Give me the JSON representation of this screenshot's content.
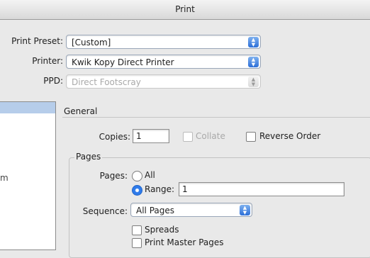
{
  "window": {
    "title": "Print"
  },
  "top": {
    "preset_label": "Print Preset:",
    "preset_value": "[Custom]",
    "printer_label": "Printer:",
    "printer_value": "Kwik Kopy Direct Printer",
    "ppd_label": "PPD:",
    "ppd_value": "Direct Footscray"
  },
  "sidebar": {
    "partial_item": "m"
  },
  "general": {
    "header": "General",
    "copies_label": "Copies:",
    "copies_value": "1",
    "collate_label": "Collate",
    "reverse_label": "Reverse Order"
  },
  "pages": {
    "group_title": "Pages",
    "pages_label": "Pages:",
    "all_label": "All",
    "range_label": "Range:",
    "range_value": "1",
    "sequence_label": "Sequence:",
    "sequence_value": "All Pages",
    "spreads_label": "Spreads",
    "master_label": "Print Master Pages"
  },
  "icons": {
    "popup_arrows": "updown-arrows-icon"
  },
  "colors": {
    "accent": "#2d6fd8",
    "selection": "#b6cdea"
  }
}
